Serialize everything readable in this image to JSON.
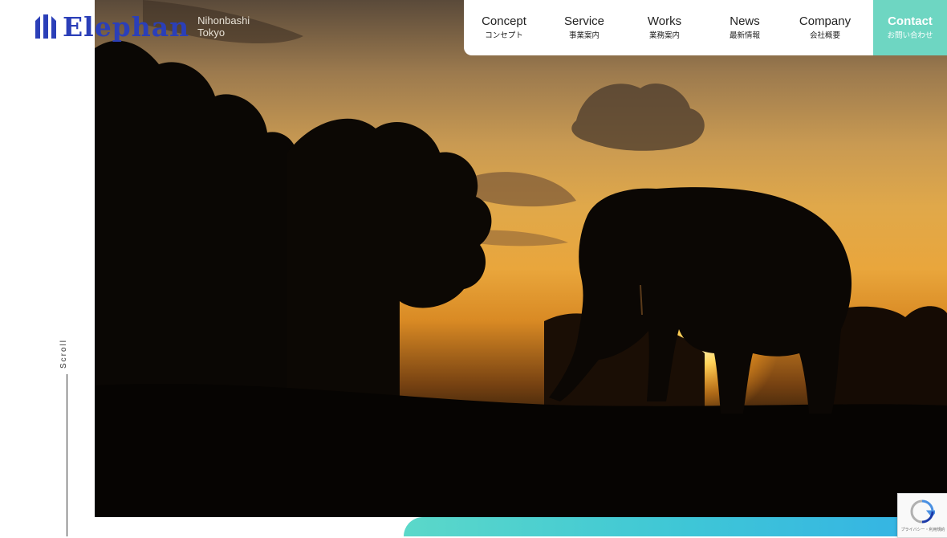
{
  "logo": {
    "name": "Elephan",
    "sub_line1": "Nihonbashi",
    "sub_line2": "Tokyo"
  },
  "nav": {
    "items": [
      {
        "en": "Concept",
        "ja": "コンセプト"
      },
      {
        "en": "Service",
        "ja": "事業案内"
      },
      {
        "en": "Works",
        "ja": "業務案内"
      },
      {
        "en": "News",
        "ja": "最新情報"
      },
      {
        "en": "Company",
        "ja": "会社概要"
      }
    ],
    "contact": {
      "en": "Contact",
      "ja": "お問い合わせ"
    }
  },
  "scroll": {
    "label": "Scroll"
  },
  "recaptcha": {
    "label": "プライバシー・利用規約"
  },
  "colors": {
    "brand": "#2b3fb8",
    "accent": "#6ed6c2",
    "bar_end": "#33b1e6"
  }
}
